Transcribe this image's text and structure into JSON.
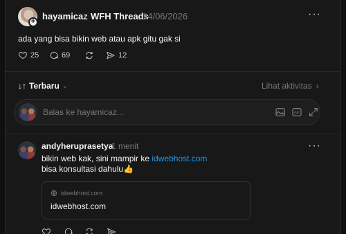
{
  "post": {
    "username": "hayamicaz",
    "thread_name": "WFH Threads",
    "date": "14/06/2026",
    "text": "ada yang bisa bikin web atau apk gitu gak si",
    "likes": "25",
    "comments": "69",
    "shares": "12",
    "icons": [
      "heart-icon",
      "comment-icon",
      "repost-icon",
      "share-icon",
      "more-icon",
      "chevron-right-icon"
    ]
  },
  "sort": {
    "label": "Terbaru",
    "activity_label": "Lihat aktivitas"
  },
  "reply": {
    "placeholder": "Balas ke hayamicaz...",
    "icons": [
      "image-icon",
      "gif-icon",
      "expand-icon"
    ]
  },
  "comment": {
    "username": "andyheruprasetya",
    "time": "1 menit",
    "text_before_link": "bikin web kak, sini mampir ke ",
    "link_text": "idwebhost.com",
    "line2": "bisa konsultasi dahulu👍",
    "card_domain": "idwebhost.com",
    "card_title": "idwebhost.com"
  },
  "colors": {
    "background": "#101010",
    "panel": "#181818",
    "text": "#f3f5f7",
    "muted": "#777777",
    "link": "#1d9bf0"
  }
}
